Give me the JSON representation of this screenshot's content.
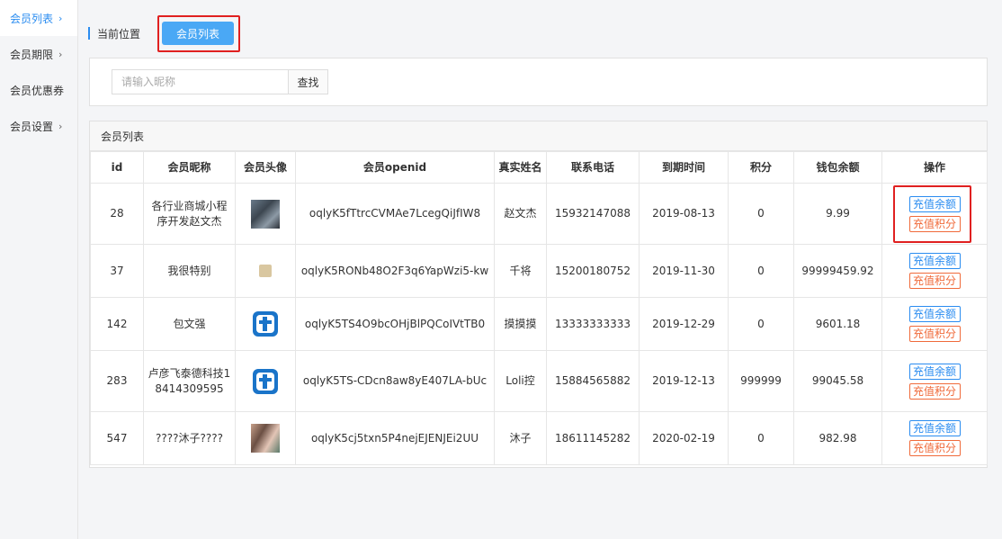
{
  "sidebar": {
    "items": [
      {
        "label": "会员列表",
        "active": true
      },
      {
        "label": "会员期限",
        "active": false
      },
      {
        "label": "会员优惠券",
        "active": false
      },
      {
        "label": "会员设置",
        "active": false
      }
    ]
  },
  "breadcrumb": {
    "label": "当前位置",
    "current": "会员列表"
  },
  "search": {
    "placeholder": "请输入昵称",
    "button": "查找"
  },
  "list": {
    "title": "会员列表",
    "columns": [
      "id",
      "会员昵称",
      "会员头像",
      "会员openid",
      "真实姓名",
      "联系电话",
      "到期时间",
      "积分",
      "钱包余额",
      "操作"
    ],
    "rows": [
      {
        "id": "28",
        "nickname": "各行业商城小程序开发赵文杰",
        "avatar": "photo-icon",
        "openid": "oqlyK5fTtrcCVMAe7LcegQiJfIW8",
        "realname": "赵文杰",
        "phone": "15932147088",
        "expire": "2019-08-13",
        "points": "0",
        "balance": "9.99"
      },
      {
        "id": "37",
        "nickname": "我很特别",
        "avatar": "small-image-icon",
        "openid": "oqlyK5RONb48O2F3q6YapWzi5-kw",
        "realname": "千将",
        "phone": "15200180752",
        "expire": "2019-11-30",
        "points": "0",
        "balance": "99999459.92"
      },
      {
        "id": "142",
        "nickname": "包文强",
        "avatar": "t-logo-icon",
        "openid": "oqlyK5TS4O9bcOHjBlPQCoIVtTB0",
        "realname": "摸摸摸",
        "phone": "13333333333",
        "expire": "2019-12-29",
        "points": "0",
        "balance": "9601.18"
      },
      {
        "id": "283",
        "nickname": "卢彦飞泰德科技18414309595",
        "avatar": "t-logo-icon",
        "openid": "oqlyK5TS-CDcn8aw8yE407LA-bUc",
        "realname": "Loli控",
        "phone": "15884565882",
        "expire": "2019-12-13",
        "points": "999999",
        "balance": "99045.58"
      },
      {
        "id": "547",
        "nickname": "????沐子????",
        "avatar": "photo-icon",
        "openid": "oqlyK5cj5txn5P4nejEJENJEi2UU",
        "realname": "沐子",
        "phone": "18611145282",
        "expire": "2020-02-19",
        "points": "0",
        "balance": "982.98"
      }
    ],
    "ops": {
      "recharge_balance": "充值余额",
      "recharge_points": "充值积分"
    }
  },
  "colors": {
    "accent": "#2a8cf0",
    "button_primary": "#4aa8f5",
    "highlight": "#e02020",
    "op_red": "#f06a3a"
  }
}
